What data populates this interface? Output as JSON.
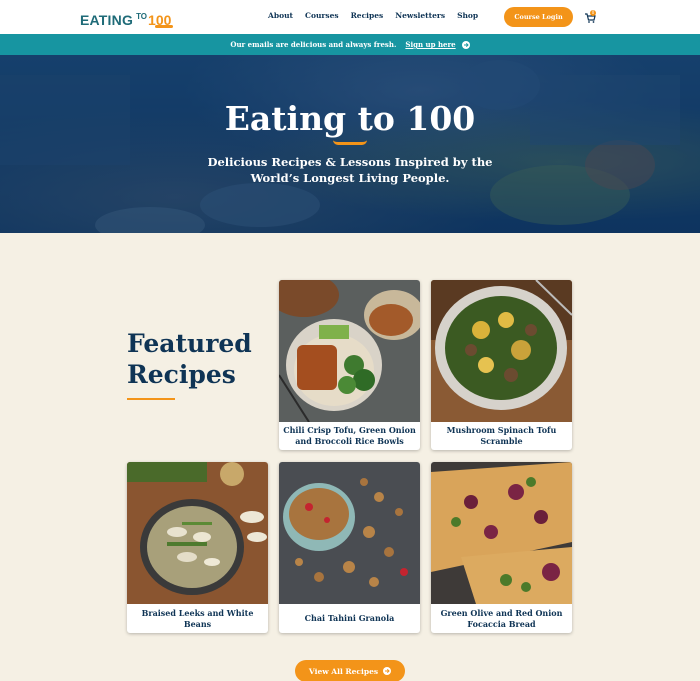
{
  "header": {
    "logo_text": "EATING TO 100",
    "nav": [
      "About",
      "Courses",
      "Recipes",
      "Newsletters",
      "Shop"
    ],
    "course_login": "Course Login",
    "cart_count": "0"
  },
  "announcement": {
    "message": "Our emails are delicious and always fresh.",
    "link": "Sign up here"
  },
  "hero": {
    "title": "Eating to 100",
    "subtitle": "Delicious Recipes & Lessons Inspired by the World’s Longest Living People."
  },
  "featured": {
    "title": "Featured Recipes",
    "recipes": [
      {
        "title": "Chili Crisp Tofu, Green Onion and Broccoli Rice Bowls"
      },
      {
        "title": "Mushroom Spinach Tofu Scramble"
      },
      {
        "title": "Braised Leeks and White Beans"
      },
      {
        "title": "Chai Tahini Granola"
      },
      {
        "title": "Green Olive and Red Onion Focaccia Bread"
      }
    ],
    "view_all": "View All Recipes"
  },
  "colors": {
    "navy": "#0f3455",
    "teal": "#1795a1",
    "orange": "#f39419",
    "cream": "#f5f0e4"
  }
}
